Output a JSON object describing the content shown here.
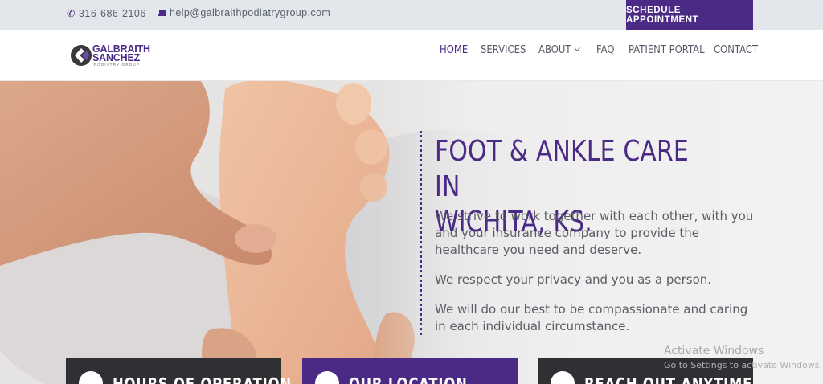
{
  "topbar": {
    "phone": "316-686-2106",
    "email": "help@galbraithpodiatrygroup.com",
    "schedule_label": "SCHEDULE APPOINTMENT",
    "accent": "#4b2a86"
  },
  "logo": {
    "line1": "GALBRAITH",
    "line2": "SANCHEZ",
    "line3": "PODIATRY GROUP"
  },
  "nav": {
    "items": [
      {
        "label": "HOME",
        "active": true
      },
      {
        "label": "SERVICES"
      },
      {
        "label": "ABOUT",
        "has_dropdown": true
      },
      {
        "label": "FAQ"
      },
      {
        "label": "PATIENT PORTAL"
      },
      {
        "label": "CONTACT"
      }
    ]
  },
  "hero": {
    "title_line1": "FOOT & ANKLE CARE IN",
    "title_line2": "WICHITA, KS.",
    "paragraph1": "We strive to work together with each other, with you and your insurance company to provide the healthcare you need and deserve.",
    "paragraph2": "We respect your privacy and you as a person.",
    "paragraph3": "We will do our best to be compassionate and caring in each individual circumstance."
  },
  "cards": [
    {
      "title": "HOURS OF OPERATION",
      "icon": "clock-icon",
      "color": "#2f3033"
    },
    {
      "title": "OUR LOCATION",
      "icon": "search-icon",
      "color": "#4b2a86"
    },
    {
      "title": "REACH OUT ANYTIME",
      "icon": "phone-icon",
      "color": "#2f3033"
    }
  ],
  "watermark": {
    "line1": "Activate Windows",
    "line2": "Go to Settings to activate Windows."
  }
}
